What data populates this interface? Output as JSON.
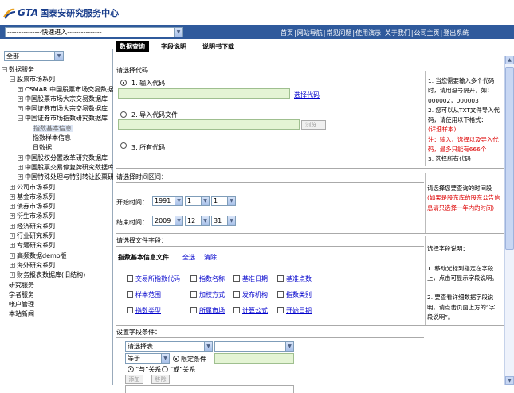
{
  "header": {
    "logo_text": "GTA",
    "logo_cn": "国泰安研究服务中心",
    "quick_select": "---------------快速进入---------------",
    "nav": [
      "首页",
      "网站导航",
      "常见问题",
      "使用演示",
      "关于我们",
      "公司主页",
      "登出系统"
    ]
  },
  "left": {
    "select_value": "全部",
    "tree": [
      {
        "label": "数据服务",
        "box": "-",
        "indent": 0
      },
      {
        "label": "股票市场系列",
        "box": "-",
        "indent": 1
      },
      {
        "label": "CSMAR 中国股票市场交易数据",
        "box": "+",
        "indent": 2
      },
      {
        "label": "中国股票市场大宗交易数据库",
        "box": "+",
        "indent": 2
      },
      {
        "label": "中国证券市场大宗交易数据库",
        "box": "+",
        "indent": 2
      },
      {
        "label": "中国证券市场指数研究数据库",
        "box": "-",
        "indent": 2
      },
      {
        "label": "指数基本信息",
        "box": "",
        "indent": 3,
        "selected": true
      },
      {
        "label": "指数样本信息",
        "box": "",
        "indent": 3
      },
      {
        "label": "日数据",
        "box": "",
        "indent": 3
      },
      {
        "label": "中国股权分置改革研究数据库",
        "box": "+",
        "indent": 2
      },
      {
        "label": "中国股票交易停复牌研究数据库",
        "box": "+",
        "indent": 2
      },
      {
        "label": "中国特殊处理与特别转让股票研究",
        "box": "+",
        "indent": 2
      },
      {
        "label": "公司市场系列",
        "box": "+",
        "indent": 1
      },
      {
        "label": "基金市场系列",
        "box": "+",
        "indent": 1
      },
      {
        "label": "债券市场系列",
        "box": "+",
        "indent": 1
      },
      {
        "label": "衍生市场系列",
        "box": "+",
        "indent": 1
      },
      {
        "label": "经济研究系列",
        "box": "+",
        "indent": 1
      },
      {
        "label": "行业研究系列",
        "box": "+",
        "indent": 1
      },
      {
        "label": "专题研究系列",
        "box": "+",
        "indent": 1
      },
      {
        "label": "高频数据demo版",
        "box": "+",
        "indent": 1
      },
      {
        "label": "海外研究系列",
        "box": "+",
        "indent": 1
      },
      {
        "label": "财务报表数据库(旧结构)",
        "box": "+",
        "indent": 1
      },
      {
        "label": "研究服务",
        "box": "",
        "indent": 0
      },
      {
        "label": "学者服务",
        "box": "",
        "indent": 0
      },
      {
        "label": "帐户管理",
        "box": "",
        "indent": 0
      },
      {
        "label": "本站新闻",
        "box": "",
        "indent": 0
      }
    ]
  },
  "tabs": [
    "数据查询",
    "字段说明",
    "说明书下载"
  ],
  "code": {
    "title": "请选择代码",
    "opt1": "1. 输入代码",
    "select_code": "选择代码",
    "opt2": "2. 导入代码文件",
    "browse": "浏览...",
    "opt3": "3. 所有代码",
    "help": [
      "1. 当您需要输入多个代码",
      "时，请用逗号隔开，如：",
      "000002，000003",
      "2. 您可以从TXT文件导入代",
      "码，请使用以下格式：",
      "(详细样本)",
      "注：输入、选择以及导入代",
      "码，最多只能有666个",
      "3. 选择所有代码"
    ]
  },
  "time": {
    "title": "请选择时间区间：",
    "start_label": "开始时间：",
    "start": [
      "1991",
      "1",
      "1"
    ],
    "end_label": "结束时间：",
    "end": [
      "2009",
      "12",
      "31"
    ],
    "help1": "请选择您要查询的时间段",
    "help2": "(如果是股东库的股东公告信",
    "help3": "息请只选择一年内的时间)"
  },
  "fields": {
    "title": "请选择文件字段：",
    "header": "指数基本信息文件",
    "select_all": "全选",
    "clear": "清除",
    "items": [
      "交易所指数代码",
      "指数名称",
      "基准日期",
      "基准点数",
      "样本范围",
      "加权方式",
      "发布机构",
      "指数类别",
      "指数类型",
      "所属市场",
      "计算公式",
      "开始日期"
    ],
    "help": [
      "选择字段说明：",
      "",
      "1. 移动光标到指定在字段",
      "上，点击可显示字段说明。",
      "",
      "2. 要查看详细数据字段说",
      "明，请点击页面上方的“字",
      "段说明”。"
    ]
  },
  "conditions": {
    "title": "设置字段条件：",
    "table_select": "请选择表……",
    "op": "等于",
    "limit_label": "限定条件",
    "and_label": "“与”关系",
    "or_label": "“或”关系",
    "add": "添加",
    "remove": "移除"
  }
}
